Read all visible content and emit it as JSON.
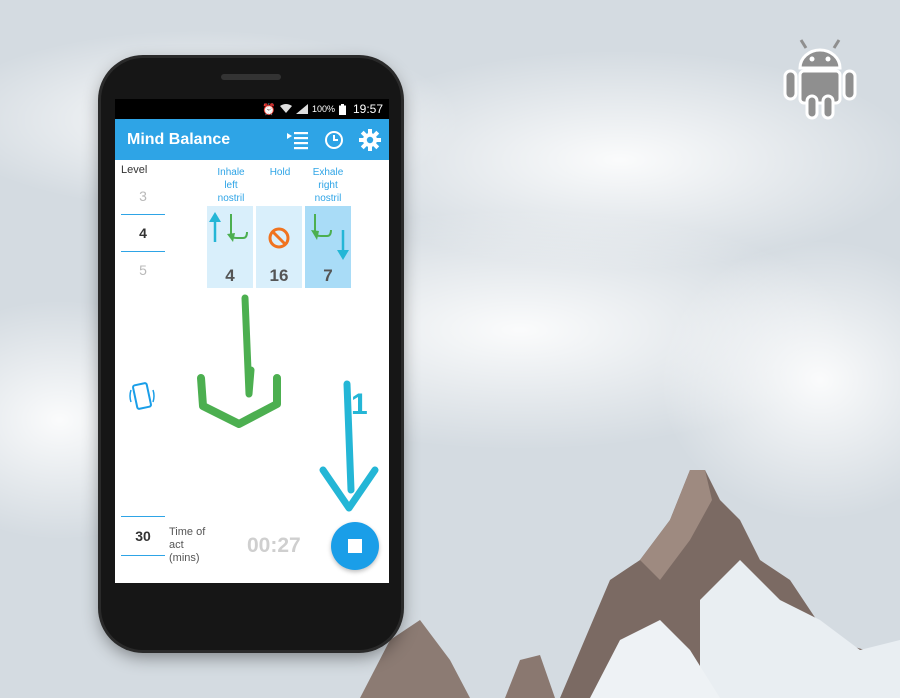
{
  "status_bar": {
    "battery": "100%",
    "time": "19:57"
  },
  "app": {
    "title": "Mind Balance",
    "actions": [
      "list-icon",
      "clock-icon",
      "gear-icon"
    ]
  },
  "level": {
    "label": "Level",
    "items": [
      "3",
      "4",
      "5"
    ],
    "selected": "4"
  },
  "phases": [
    {
      "head": "Inhale\nleft\nnostril",
      "value": "4",
      "icon": "inhale-left-icon"
    },
    {
      "head": "Hold",
      "value": "16",
      "icon": "no-entry-icon"
    },
    {
      "head": "Exhale\nright\nnostril",
      "value": "7",
      "icon": "exhale-right-icon",
      "active": true
    }
  ],
  "time_of_act": {
    "label": "Time of\nact\n(mins)",
    "selected": "30"
  },
  "timer": {
    "elapsed": "00:27"
  },
  "annotation": {
    "step": "1"
  },
  "colors": {
    "accent": "#2ea4e6",
    "stop": "#1a9ee8",
    "green": "#4caf50",
    "cyan": "#24b6d6",
    "orange": "#f0731f"
  }
}
